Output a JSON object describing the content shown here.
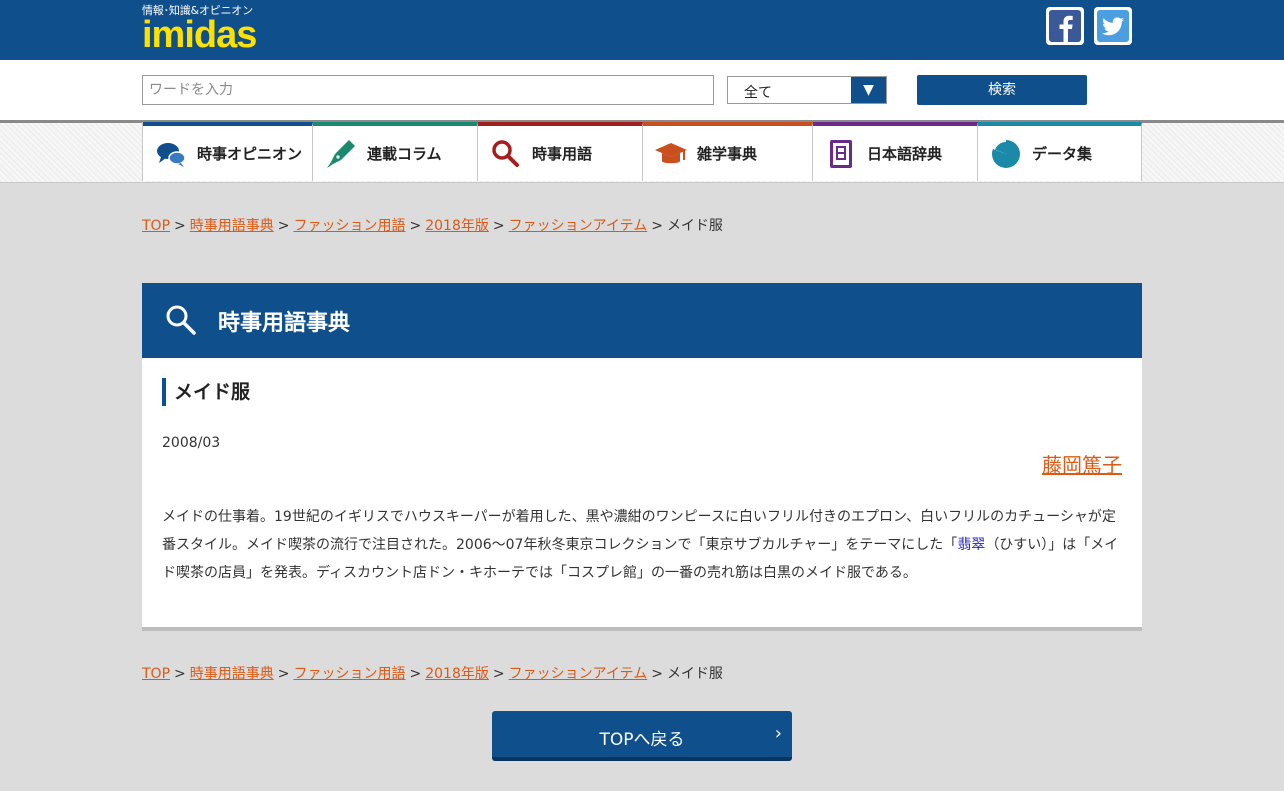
{
  "header": {
    "tagline": "情報･知識&オピニオン",
    "brand": "imidas",
    "social": [
      "facebook-icon",
      "twitter-icon"
    ]
  },
  "search": {
    "placeholder": "ワードを入力",
    "value": "",
    "scope_selected": "全て",
    "button_label": "検索"
  },
  "nav": {
    "items": [
      {
        "label": "時事オピニオン",
        "icon": "speech-bubbles-icon",
        "color": "#0e4f8c"
      },
      {
        "label": "連載コラム",
        "icon": "pen-icon",
        "color": "#1a8a6e"
      },
      {
        "label": "時事用語",
        "icon": "search-icon",
        "color": "#a31f1f"
      },
      {
        "label": "雑学事典",
        "icon": "graduation-cap-icon",
        "color": "#c9501e"
      },
      {
        "label": "日本語辞典",
        "icon": "dictionary-icon",
        "color": "#6a2a8a"
      },
      {
        "label": "データ集",
        "icon": "pie-chart-icon",
        "color": "#1a8aa8"
      }
    ]
  },
  "breadcrumb": {
    "links": [
      "TOP",
      "時事用語事典",
      "ファッション用語",
      "2018年版",
      "ファッションアイテム"
    ],
    "separator": ">",
    "current": "メイド服"
  },
  "article": {
    "section_title": "時事用語事典",
    "term": "メイド服",
    "date": "2008/03",
    "author": "藤岡篤子",
    "body_before": "メイドの仕事着。19世紀のイギリスでハウスキーパーが着用した、黒や濃紺のワンピースに白いフリル付きのエプロン、白いフリルのカチューシャが定番スタイル。メイド喫茶の流行で注目された。2006～07年秋冬東京コレクションで「東京サブカルチャー」をテーマにした「",
    "body_keyword": "翡翠",
    "body_after": "（ひすい）」は「メイド喫茶の店員」を発表。ディスカウント店ドン・キホーテでは「コスプレ館」の一番の売れ筋は白黒のメイド服である。"
  },
  "footer": {
    "top_button_label": "TOPへ戻る"
  },
  "colors": {
    "primary": "#0e4f8c",
    "link": "#d95b17",
    "logo": "#ffe100"
  }
}
